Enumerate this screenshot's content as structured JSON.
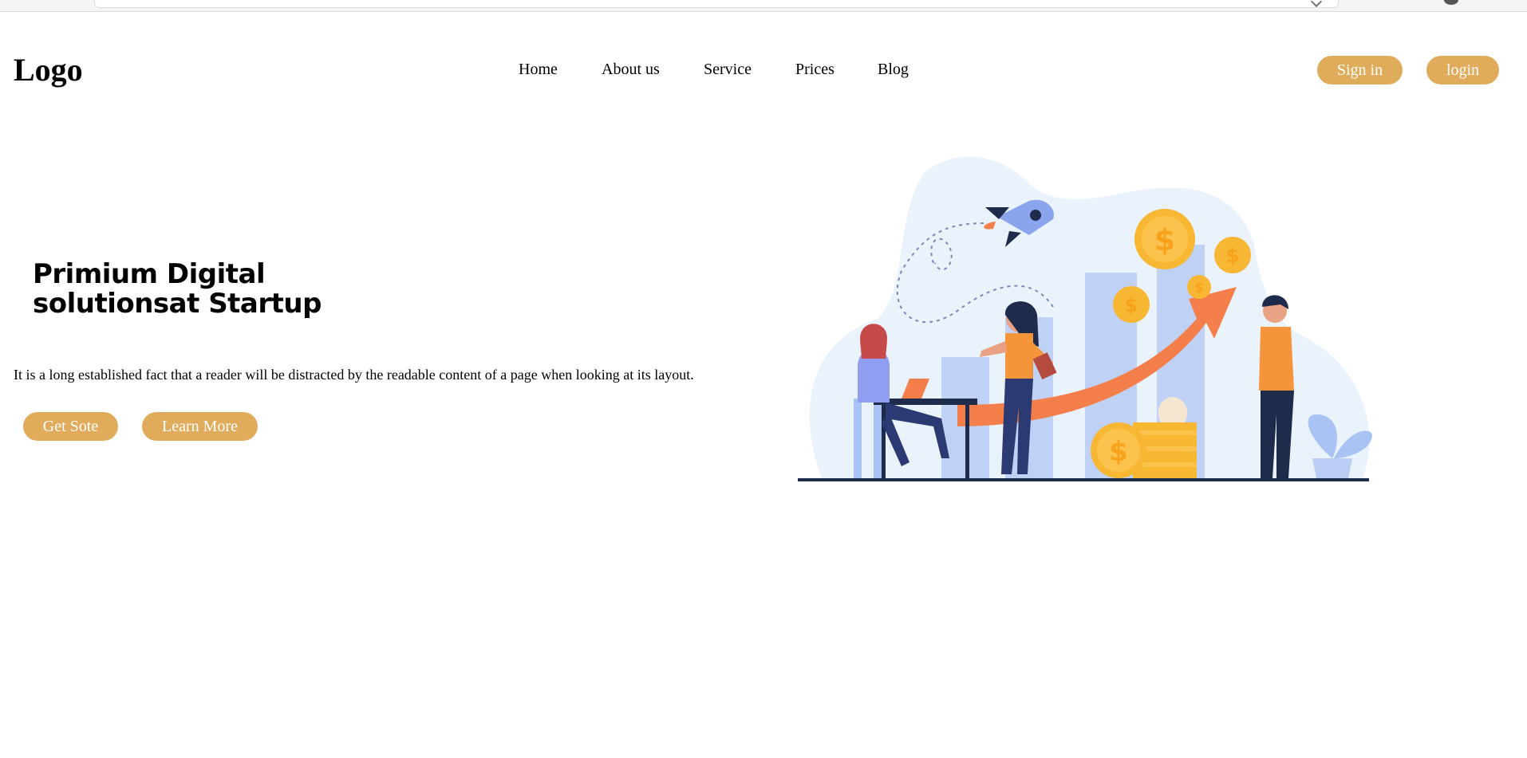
{
  "header": {
    "logo": "Logo",
    "nav": [
      {
        "label": "Home"
      },
      {
        "label": "About us"
      },
      {
        "label": "Service"
      },
      {
        "label": "Prices"
      },
      {
        "label": "Blog"
      }
    ],
    "signin_label": "Sign in",
    "login_label": "login"
  },
  "hero": {
    "title_line1": "Primium Digital",
    "title_line2": "solutionsat Startup",
    "text": "It is a long established fact that a reader will be distracted by the readable content of a page when looking at its layout.",
    "primary_button": "Get Sote",
    "secondary_button": "Learn More"
  },
  "theme": {
    "accent": "#e0ab5a",
    "illustration_blob": "#eaf2fb",
    "bars": "#bfd1f5",
    "arrow": "#f47f4b",
    "coin": "#f7b733",
    "dark": "#1e2b4a"
  }
}
